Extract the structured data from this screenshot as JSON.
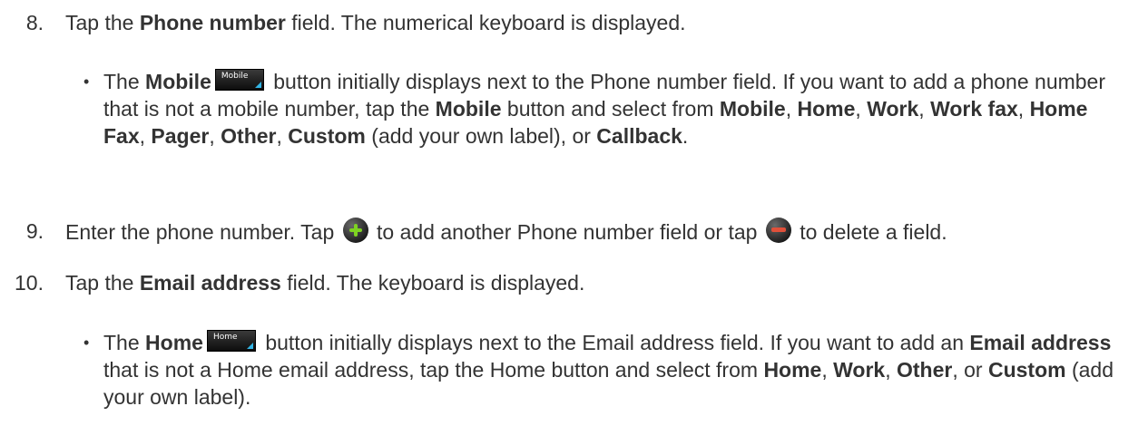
{
  "steps": [
    {
      "number": "8.",
      "text_a": "Tap the ",
      "bold_a": "Phone number",
      "text_b": " field. The numerical keyboard is displayed."
    },
    {
      "number": "9.",
      "text_a": "Enter the phone number. Tap ",
      "text_b": " to add another Phone number field or tap ",
      "text_c": " to delete a field."
    },
    {
      "number": "10.",
      "text_a": "Tap the ",
      "bold_a": "Email address",
      "text_b": " field. The keyboard is displayed."
    }
  ],
  "bullet1": {
    "t1": "The ",
    "b1": "Mobile",
    "btn": "Mobile",
    "t2": " button initially displays next to the Phone number field. If you want to add a phone number that is not a mobile number, tap the ",
    "b2": "Mobile",
    "t3": " button and select from ",
    "b3": "Mobile",
    "s1": ", ",
    "b4": "Home",
    "s2": ", ",
    "b5": "Work",
    "s3": ", ",
    "b6": "Work fax",
    "s4": ", ",
    "b7": "Home Fax",
    "s5": ", ",
    "b8": "Pager",
    "s6": ", ",
    "b9": "Other",
    "s7": ", ",
    "b10": "Custom",
    "t4": " (add your own label), or ",
    "b11": "Callback",
    "t5": "."
  },
  "bullet2": {
    "t1": "The ",
    "b1": "Home",
    "btn": "Home",
    "t2": " button initially displays next to the Email address field. If you want to add an ",
    "b2": "Email address",
    "t3": " that is not a Home email address, tap the Home button and select from ",
    "b3": "Home",
    "s1": ", ",
    "b4": "Work",
    "s2": ", ",
    "b5": "Other",
    "t4": ", or ",
    "b6": "Custom",
    "t5": " (add your own label)."
  },
  "icons": {
    "add": "plus-circle-icon",
    "delete": "minus-circle-icon",
    "add_color": "#7ed321",
    "delete_color": "#e0503a",
    "dropdown_accent": "#33b5e5"
  }
}
